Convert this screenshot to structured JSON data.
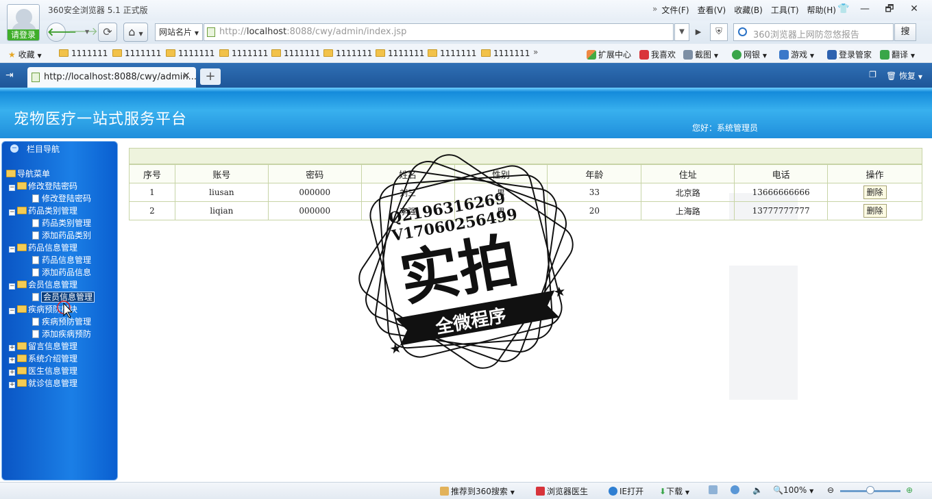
{
  "browser": {
    "app_title": "360安全浏览器 5.1 正式版",
    "login_label": "请登录",
    "menu": [
      "文件(F)",
      "查看(V)",
      "收藏(B)",
      "工具(T)",
      "帮助(H)"
    ],
    "win_controls": [
      "—",
      "🗗",
      "✕"
    ],
    "address_card": "网站名片",
    "address_prefix": "http://",
    "address_host": "localhost",
    "address_rest": ":8088/cwy/admin/index.jsp",
    "search_placeholder": "360浏览器上网防忽悠报告",
    "search_button": "搜",
    "favorites_label": "收藏",
    "favorites": [
      "1111111",
      "1111111",
      "1111111",
      "1111111",
      "1111111",
      "1111111",
      "1111111",
      "1111111",
      "1111111"
    ],
    "tools": [
      "扩展中心",
      "我喜欢",
      "截图",
      "网银",
      "游戏",
      "登录管家",
      "翻译"
    ],
    "tab_title": "http://localhost:8088/cwy/admin...",
    "tab_restore": "恢复",
    "status": {
      "recommend": "推荐到360搜索",
      "doctor": "浏览器医生",
      "ie_open": "IE打开",
      "download": "下载",
      "zoom": "100%"
    }
  },
  "site": {
    "title": "宠物医疗一站式服务平台",
    "greeting": "您好：系统管理员"
  },
  "nav": {
    "panel_title": "栏目导航",
    "root": "导航菜单",
    "groups": [
      {
        "label": "修改登陆密码",
        "children": [
          "修改登陆密码"
        ]
      },
      {
        "label": "药品类别管理",
        "children": [
          "药品类别管理",
          "添加药品类别"
        ]
      },
      {
        "label": "药品信息管理",
        "children": [
          "药品信息管理",
          "添加药品信息"
        ]
      },
      {
        "label": "会员信息管理",
        "children": [
          "会员信息管理"
        ]
      },
      {
        "label": "疾病预防模块",
        "children": [
          "疾病预防管理",
          "添加疾病预防"
        ]
      },
      {
        "label": "留言信息管理",
        "children": []
      },
      {
        "label": "系统介绍管理",
        "children": []
      },
      {
        "label": "医生信息管理",
        "children": []
      },
      {
        "label": "就诊信息管理",
        "children": []
      }
    ]
  },
  "table": {
    "headers": [
      "序号",
      "账号",
      "密码",
      "姓名",
      "性别",
      "年龄",
      "住址",
      "电话",
      "操作"
    ],
    "rows": [
      {
        "no": "1",
        "account": "liusan",
        "password": "000000",
        "name": "刘三",
        "gender": "男",
        "age": "33",
        "address": "北京路",
        "phone": "13666666666",
        "action": "删除"
      },
      {
        "no": "2",
        "account": "liqian",
        "password": "000000",
        "name": "李强",
        "gender": "男",
        "age": "20",
        "address": "上海路",
        "phone": "13777777777",
        "action": "删除"
      }
    ]
  },
  "watermark": {
    "line1": "Q2196316269",
    "line2": "V17060256499",
    "big": "实拍",
    "ribbon": "全微程序"
  },
  "colors": {
    "header_blue": "#1f8edb",
    "nav_blue": "#1b7fe6",
    "table_border": "#c7d4a6",
    "login_green": "#3fae2a"
  }
}
